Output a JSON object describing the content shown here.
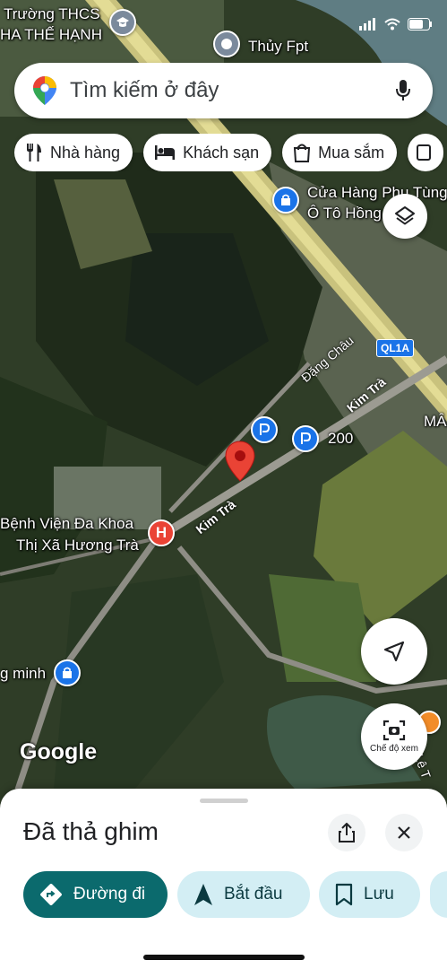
{
  "status_bar": {
    "time_hidden": true
  },
  "map": {
    "labels": {
      "school": "Trường THCS",
      "school_line2": "HA THẾ HẠNH",
      "thuy_fpt": "Thủy Fpt",
      "shop_line1": "Cửa Hàng Phụ Tùng",
      "shop_line2": "Ô Tô Hồng",
      "road_dang_chau": "Đặng Châu",
      "road_kim_tra_1": "Kim Trà",
      "road_kim_tra_2": "Kim Trà",
      "road_ql1a": "QL1A",
      "ma_cut": "MÂ",
      "parking_200": "200",
      "hospital_line1": "Bệnh Viện Đa Khoa",
      "hospital_line2": "Thị Xã Hương Trà",
      "g_minh": "g minh",
      "le_tr": "Lê T",
      "google": "Google"
    }
  },
  "search": {
    "placeholder": "Tìm kiếm ở đây"
  },
  "chips": [
    {
      "label": "Nhà hàng",
      "icon": "restaurant-icon"
    },
    {
      "label": "Khách sạn",
      "icon": "hotel-icon"
    },
    {
      "label": "Mua sắm",
      "icon": "shopping-icon"
    }
  ],
  "fab": {
    "layers_icon": "layers-icon",
    "locate_icon": "navigation-arrow-icon",
    "view_mode_label": "Chế độ xem"
  },
  "sheet": {
    "title": "Đã thả ghim",
    "actions": [
      {
        "label": "Đường đi",
        "icon": "directions-icon"
      },
      {
        "label": "Bắt đầu",
        "icon": "navigate-icon"
      },
      {
        "label": "Lưu",
        "icon": "bookmark-icon"
      }
    ]
  },
  "colors": {
    "accent_teal": "#0b6a6d",
    "chip_light": "#d3eef4",
    "pin_red": "#ea4335",
    "parking_blue": "#1a73e8"
  }
}
